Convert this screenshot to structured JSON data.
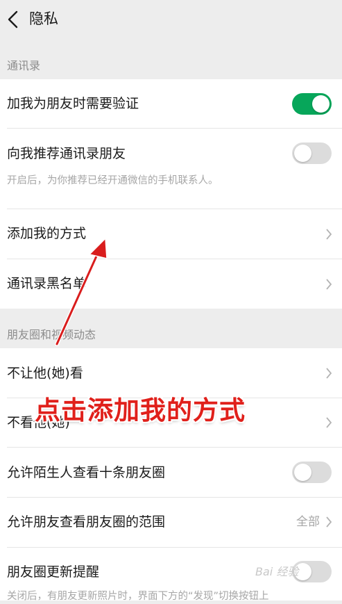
{
  "header": {
    "title": "隐私"
  },
  "contacts_section": {
    "label": "通讯录",
    "items": [
      {
        "label": "加我为朋友时需要验证",
        "toggle": "on"
      },
      {
        "label": "向我推荐通讯录朋友",
        "sub": "开启后，为你推荐已经开通微信的手机联系人。",
        "toggle": "off"
      },
      {
        "label": "添加我的方式"
      },
      {
        "label": "通讯录黑名单"
      }
    ]
  },
  "moments_section": {
    "label": "朋友圈和视频动态",
    "items": [
      {
        "label": "不让他(她)看"
      },
      {
        "label": "不看他(她)"
      },
      {
        "label": "允许陌生人查看十条朋友圈",
        "toggle": "off"
      },
      {
        "label": "允许朋友查看朋友圈的范围",
        "value": "全部"
      },
      {
        "label": "朋友圈更新提醒",
        "toggle": "off",
        "sub": "关闭后，有朋友更新照片时，界面下方的“发现”切换按钮上"
      }
    ]
  },
  "annotation": {
    "text": "点击添加我的方式",
    "color": "#e0201b"
  },
  "watermark": {
    "text": "Bai 经验"
  },
  "colors": {
    "accent": "#07a65a",
    "background": "#ededed"
  }
}
